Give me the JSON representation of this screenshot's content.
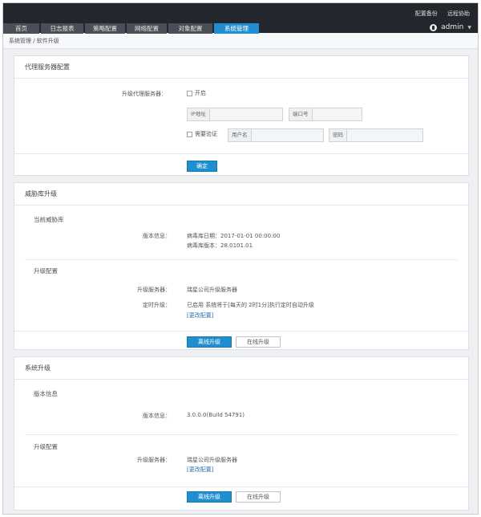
{
  "header": {
    "links": [
      "配置备份",
      "远程协助"
    ],
    "user": "admin",
    "tabs": [
      "首页",
      "日志报表",
      "策略配置",
      "网络配置",
      "对象配置",
      "系统管理"
    ],
    "active_tab": "系统管理"
  },
  "breadcrumb": "系统管理 / 软件升级",
  "proxy": {
    "title": "代理服务器配置",
    "upgrade_proxy_label": "升级代理服务器：",
    "enable_label": "开启",
    "ip_label": "IP地址",
    "port_label": "端口号",
    "auth_label": "需要验证",
    "username_label": "用户名",
    "password_label": "密码",
    "confirm_button": "确定"
  },
  "threat": {
    "title": "威胁库升级",
    "current_section": "当前威胁库",
    "version_label": "版本信息：",
    "virus_date": "病毒库日期：2017-01-01 00:00:00",
    "virus_version": "病毒库版本：28.0101.01",
    "upgrade_config_section": "升级配置",
    "server_label": "升级服务器：",
    "server_value": "瑞星公司升级服务器",
    "timed_label": "定时升级：",
    "timed_value": "已启用  系统将于[每天的 2时1分]执行定时自动升级",
    "change_link": "[更改配置]",
    "offline_button": "离线升级",
    "online_button": "在线升级"
  },
  "system": {
    "title": "系统升级",
    "version_section": "版本信息",
    "version_label": "版本信息：",
    "version_value": "3.0.0.0(Build 54791)",
    "upgrade_config_section": "升级配置",
    "server_label": "升级服务器：",
    "server_value": "瑞星公司升级服务器",
    "change_link": "[更改配置]",
    "offline_button": "离线升级",
    "online_button": "在线升级"
  },
  "colors": {
    "topbar": "#23272d",
    "accent": "#1f8fd0"
  }
}
